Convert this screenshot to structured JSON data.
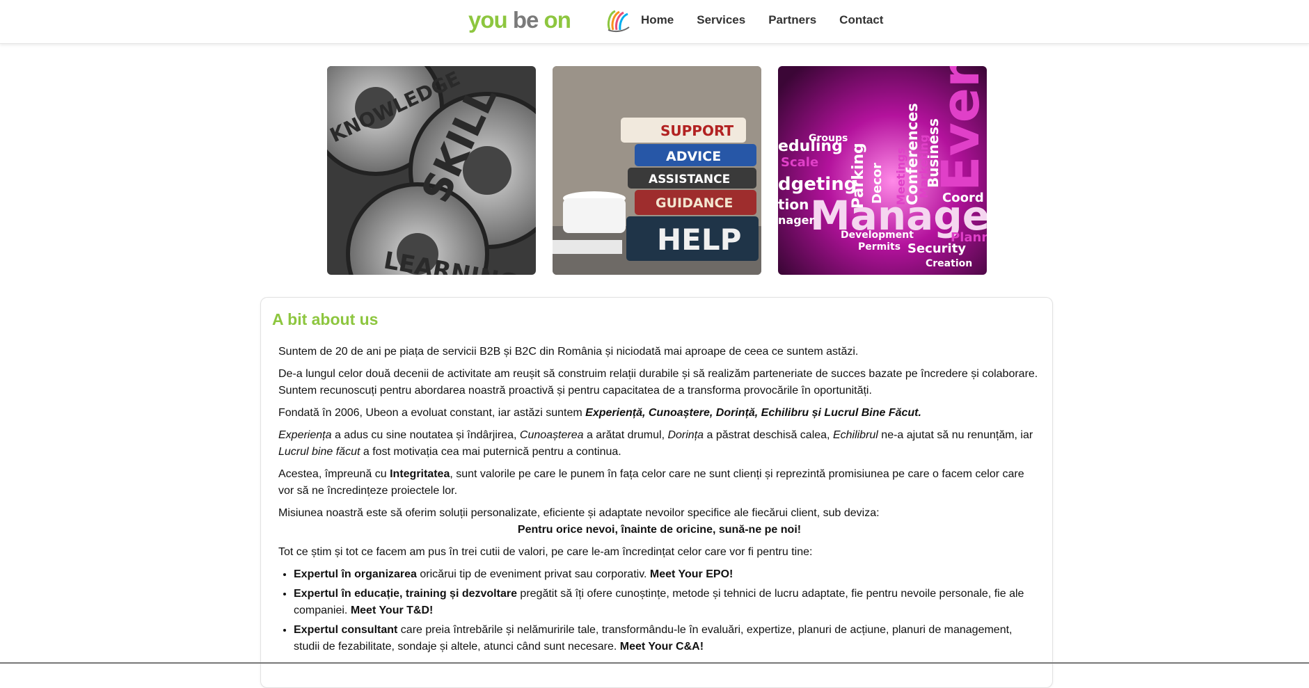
{
  "header": {
    "logo": {
      "part1": "you",
      "part2": "be",
      "part3": "on"
    },
    "nav": [
      "Home",
      "Services",
      "Partners",
      "Contact"
    ],
    "icon": "colored-swirl-icon",
    "colors": {
      "green": "#8dc63f",
      "gray": "#7a7a7a"
    }
  },
  "tiles": [
    {
      "name": "gears-image",
      "words": [
        "KNOWLEDGE",
        "SKILL",
        "LEARNING"
      ]
    },
    {
      "name": "books-image",
      "words": [
        "SUPPORT",
        "ADVICE",
        "ASSISTANCE",
        "GUIDANCE",
        "HELP"
      ]
    },
    {
      "name": "event-wordcloud-image",
      "words": [
        "Event",
        "Management",
        "Conferences",
        "Business",
        "Parking",
        "Security",
        "Creation",
        "Development",
        "Permits",
        "Coord",
        "Planni",
        "Meetings",
        "Marketing",
        "Decor",
        "Groups",
        "Scale",
        "dgeting",
        "eduling",
        "nager",
        "tion"
      ]
    }
  ],
  "about": {
    "title": "A bit about us",
    "p1": "Suntem de 20 de ani pe piața de servicii B2B și B2C din România și niciodată mai aproape de ceea ce suntem astăzi.",
    "p2": "De-a lungul celor două decenii de activitate am reușit să construim relații durabile și să realizăm parteneriate de succes bazate pe încredere și colaborare. Suntem recunoscuți pentru abordarea noastră proactivă și pentru capacitatea de a transforma provocările în oportunități.",
    "p3_text": "Fondată în 2006, Ubeon a evoluat constant, iar astăzi suntem ",
    "p3_bold": "Experiență, Cunoaștere, Dorință, Echilibru și Lucrul Bine Făcut.",
    "p4": {
      "i1": "Experiența",
      "t1": " a adus cu sine noutatea și îndârjirea, ",
      "i2": "Cunoașterea",
      "t2": " a arătat drumul, ",
      "i3": "Dorința",
      "t3": " a păstrat deschisă calea, ",
      "i4": "Echilibrul",
      "t4": " ne-a ajutat să nu renunțăm, iar ",
      "i5": "Lucrul bine făcut",
      "t5": " a fost motivația cea mai puternică pentru a continua."
    },
    "p5": {
      "t1": "Acestea, împreună cu ",
      "b1": "Integritatea",
      "t2": ", sunt valorile pe care le punem în fața celor care ne sunt clienți și reprezintă promisiunea pe care o facem celor care vor să ne încredințeze proiectele lor."
    },
    "p6": "Misiunea noastră este să oferim soluții personalizate, eficiente și adaptate nevoilor specifice ale fiecărui client, sub deviza:",
    "motto": "Pentru orice nevoi, înainte de oricine, sună-ne pe noi!",
    "p7": "Tot ce știm și tot ce facem am pus în trei cutii de valori, pe care le-am încredințat celor care vor fi pentru tine:",
    "bullets": [
      {
        "b": "Expertul în organizarea",
        "t": " oricărui tip de eveniment privat sau corporativ. ",
        "tag": "Meet Your EPO!"
      },
      {
        "b": "Expertul în educație, training și dezvoltare",
        "t": " pregătit să îți ofere cunoștințe, metode și tehnici de lucru adaptate, fie pentru nevoile personale, fie ale companiei. ",
        "tag": "Meet Your T&D!"
      },
      {
        "b": "Expertul consultant",
        "t": " care preia întrebările și nelămuririle tale, transformându-le în evaluări, expertize, planuri de acțiune, planuri de management, studii de fezabilitate, sondaje și altele, atunci când sunt necesare. ",
        "tag": "Meet Your C&A!"
      }
    ]
  }
}
